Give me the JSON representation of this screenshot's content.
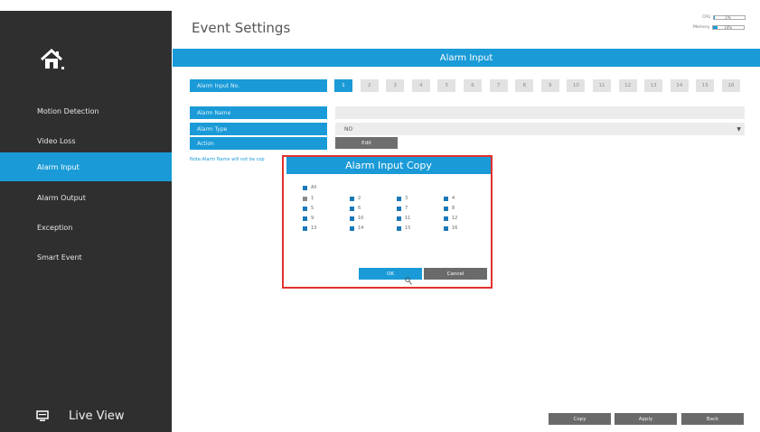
{
  "header": {
    "title": "Event Settings",
    "cpu_label": "CPU",
    "cpu_value": "1%",
    "cpu_fraction": 0.02,
    "memory_label": "Memory",
    "memory_value": "14%",
    "memory_fraction": 0.14
  },
  "sidebar": {
    "home_icon": "home-icon",
    "items": [
      {
        "label": "Motion Detection",
        "active": false
      },
      {
        "label": "Video Loss",
        "active": false
      },
      {
        "label": "Alarm Input",
        "active": true
      },
      {
        "label": "Alarm Output",
        "active": false
      },
      {
        "label": "Exception",
        "active": false
      },
      {
        "label": "Smart Event",
        "active": false
      }
    ],
    "live_view": {
      "label": "Live View",
      "icon": "monitor-icon"
    }
  },
  "section": {
    "title": "Alarm Input"
  },
  "form": {
    "alarm_input_no_label": "Alarm Input No.",
    "numbers": [
      "1",
      "2",
      "3",
      "4",
      "5",
      "6",
      "7",
      "8",
      "9",
      "10",
      "11",
      "12",
      "13",
      "14",
      "15",
      "16"
    ],
    "selected_number": "1",
    "alarm_name_label": "Alarm Name",
    "alarm_name_value": "",
    "alarm_type_label": "Alarm Type",
    "alarm_type_value": "NO",
    "action_label": "Action",
    "edit_label": "Edit",
    "note": "Note:Alarm Name will not be cop"
  },
  "dialog": {
    "title": "Alarm Input Copy",
    "all_label": "All",
    "channels": [
      "1",
      "2",
      "3",
      "4",
      "5",
      "6",
      "7",
      "8",
      "9",
      "10",
      "11",
      "12",
      "13",
      "14",
      "15",
      "16"
    ],
    "disabled_channel": "1",
    "ok_label": "OK",
    "cancel_label": "Cancel"
  },
  "footer": {
    "copy_label": "Copy",
    "apply_label": "Apply",
    "back_label": "Back"
  },
  "colors": {
    "accent": "#1a9bd7",
    "sidebar_bg": "#2f2f2f",
    "highlight": "#e0322e",
    "button_gray": "#6a6a6a"
  }
}
